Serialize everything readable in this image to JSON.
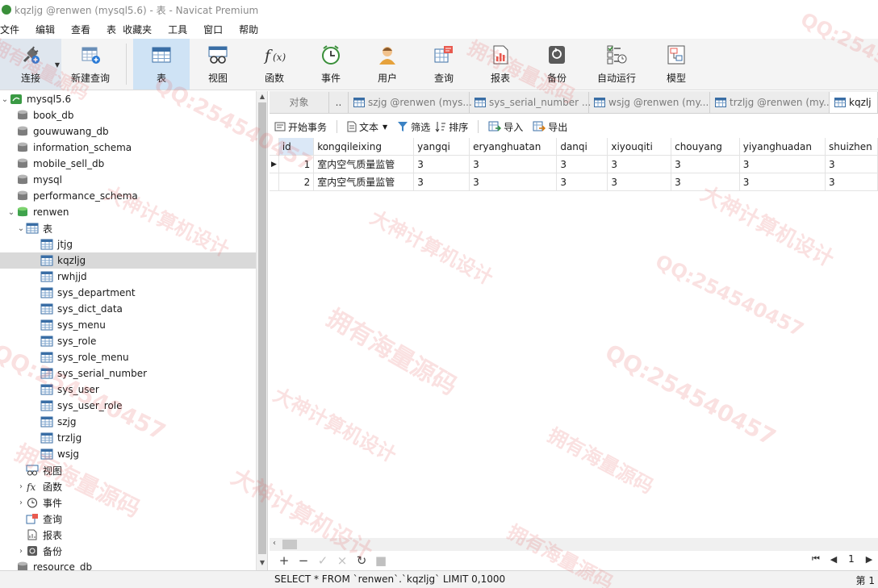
{
  "window": {
    "title": "kqzljg @renwen (mysql5.6) - 表 - Navicat Premium"
  },
  "menu": [
    "文件",
    "编辑",
    "查看",
    "表",
    "收藏夹",
    "工具",
    "窗口",
    "帮助"
  ],
  "toolbar": {
    "connect": "连接",
    "new_query": "新建查询",
    "table": "表",
    "view": "视图",
    "function": "函数",
    "event": "事件",
    "user": "用户",
    "query": "查询",
    "report": "报表",
    "backup": "备份",
    "autorun": "自动运行",
    "model": "模型"
  },
  "tree": {
    "connection": "mysql5.6",
    "databases_top": [
      "book_db",
      "gouwuwang_db",
      "information_schema",
      "mobile_sell_db",
      "mysql",
      "performance_schema"
    ],
    "active_db": "renwen",
    "tables_node": "表",
    "tables": [
      "jtjg",
      "kqzljg",
      "rwhjjd",
      "sys_department",
      "sys_dict_data",
      "sys_menu",
      "sys_role",
      "sys_role_menu",
      "sys_serial_number",
      "sys_user",
      "sys_user_role",
      "szjg",
      "trzljg",
      "wsjg"
    ],
    "selected_table": "kqzljg",
    "after_tables": [
      "视图",
      "函数",
      "事件",
      "查询",
      "报表",
      "备份"
    ],
    "last_db": "resource_db"
  },
  "tabs": {
    "objects": "对象",
    "nav": "..",
    "items": [
      "szjg @renwen (mys...",
      "sys_serial_number ...",
      "wsjg @renwen (my...",
      "trzljg @renwen (my...",
      "kqzlj"
    ]
  },
  "grid_toolbar": {
    "begin_transaction": "开始事务",
    "text": "文本",
    "filter": "筛选",
    "sort": "排序",
    "import": "导入",
    "export": "导出"
  },
  "grid": {
    "columns": [
      "id",
      "kongqileixing",
      "yangqi",
      "eryanghuatan",
      "danqi",
      "xiyouqiti",
      "chouyang",
      "yiyanghuadan",
      "shuizhen"
    ],
    "rows": [
      [
        "1",
        "室内空气质量监管",
        "3",
        "3",
        "3",
        "3",
        "3",
        "3",
        "3"
      ],
      [
        "2",
        "室内空气质量监管",
        "3",
        "3",
        "3",
        "3",
        "3",
        "3",
        "3"
      ]
    ]
  },
  "pager": {
    "page": "1"
  },
  "status": {
    "sql": "SELECT * FROM `renwen`.`kqzljg` LIMIT 0,1000",
    "record": "第 1"
  },
  "watermarks": [
    "拥有海量源码",
    "QQ:254540457",
    "大神计算机设计"
  ],
  "colors": {
    "accent": "#cfe3f5",
    "selected_row": "#d9d9d9",
    "db_active": "#3fa34d",
    "watermark": "#e15a5a"
  }
}
